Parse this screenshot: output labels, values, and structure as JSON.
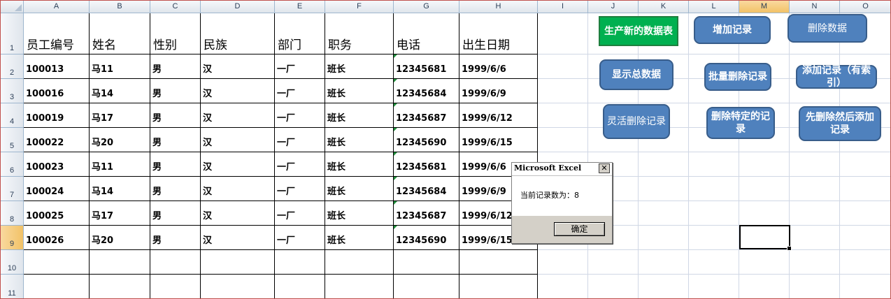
{
  "sheet": {
    "columns": [
      "A",
      "B",
      "C",
      "D",
      "E",
      "F",
      "G",
      "H",
      "I",
      "J",
      "K",
      "L",
      "M",
      "N",
      "O"
    ],
    "selected_column": "M",
    "row_numbers": [
      "1",
      "2",
      "3",
      "4",
      "5",
      "6",
      "7",
      "8",
      "9",
      "10",
      "11"
    ],
    "selected_row": "9",
    "headers": [
      "员工编号",
      "姓名",
      "性别",
      "民族",
      "部门",
      "职务",
      "电话",
      "出生日期"
    ],
    "rows": [
      [
        "100013",
        "马11",
        "男",
        "汉",
        "一厂",
        "班长",
        "12345681",
        "1999/6/6"
      ],
      [
        "100016",
        "马14",
        "男",
        "汉",
        "一厂",
        "班长",
        "12345684",
        "1999/6/9"
      ],
      [
        "100019",
        "马17",
        "男",
        "汉",
        "一厂",
        "班长",
        "12345687",
        "1999/6/12"
      ],
      [
        "100022",
        "马20",
        "男",
        "汉",
        "一厂",
        "班长",
        "12345690",
        "1999/6/15"
      ],
      [
        "100023",
        "马11",
        "男",
        "汉",
        "一厂",
        "班长",
        "12345681",
        "1999/6/6"
      ],
      [
        "100024",
        "马14",
        "男",
        "汉",
        "一厂",
        "班长",
        "12345684",
        "1999/6/9"
      ],
      [
        "100025",
        "马17",
        "男",
        "汉",
        "一厂",
        "班长",
        "12345687",
        "1999/6/12"
      ],
      [
        "100026",
        "马20",
        "男",
        "汉",
        "一厂",
        "班长",
        "12345690",
        "1999/6/15"
      ]
    ]
  },
  "buttons": [
    {
      "name": "generate-new-table-button",
      "label": "生产新的数据表",
      "style": "green bold"
    },
    {
      "name": "add-record-button",
      "label": "增加记录",
      "style": "bold"
    },
    {
      "name": "delete-data-button",
      "label": "删除数据",
      "style": ""
    },
    {
      "name": "show-total-button",
      "label": "显示总数据",
      "style": "bold"
    },
    {
      "name": "batch-delete-button",
      "label": "批量删除记录",
      "style": "bold"
    },
    {
      "name": "add-record-indexed-button",
      "label": "添加记录（有索引）",
      "style": "bold"
    },
    {
      "name": "flexible-delete-button",
      "label": "灵活删除记录",
      "style": ""
    },
    {
      "name": "delete-specific-button",
      "label": "删除特定的记录",
      "style": "bold"
    },
    {
      "name": "delete-then-add-button",
      "label": "先删除然后添加记录",
      "style": "bold"
    }
  ],
  "dialog": {
    "title": "Microsoft Excel",
    "close_glyph": "✕",
    "message": "当前记录数为：8",
    "ok_label": "确定"
  },
  "colors": {
    "button_blue": "#4f81bd",
    "button_green": "#00b050",
    "selection_orange": "#f2c267",
    "grid_line": "#d0d7e5"
  }
}
